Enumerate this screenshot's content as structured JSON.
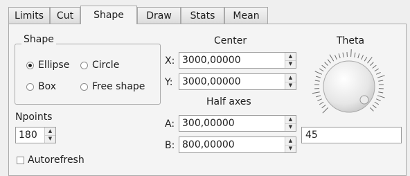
{
  "tabs": [
    {
      "label": "Limits",
      "active": false
    },
    {
      "label": "Cut",
      "active": false
    },
    {
      "label": "Shape",
      "active": true
    },
    {
      "label": "Draw",
      "active": false
    },
    {
      "label": "Stats",
      "active": false
    },
    {
      "label": "Mean",
      "active": false
    }
  ],
  "shape_group": {
    "title": "Shape",
    "options": [
      {
        "label": "Ellipse",
        "selected": true
      },
      {
        "label": "Circle",
        "selected": false
      },
      {
        "label": "Box",
        "selected": false
      },
      {
        "label": "Free shape",
        "selected": false
      }
    ]
  },
  "npoints": {
    "label": "Npoints",
    "value": "180"
  },
  "autorefresh": {
    "label": "Autorefresh",
    "checked": false
  },
  "center": {
    "title": "Center",
    "x_label": "X:",
    "x_value": "3000,00000",
    "y_label": "Y:",
    "y_value": "3000,00000"
  },
  "half_axes": {
    "title": "Half axes",
    "a_label": "A:",
    "a_value": "300,00000",
    "b_label": "B:",
    "b_value": "800,00000"
  },
  "theta": {
    "title": "Theta",
    "value": "45"
  }
}
